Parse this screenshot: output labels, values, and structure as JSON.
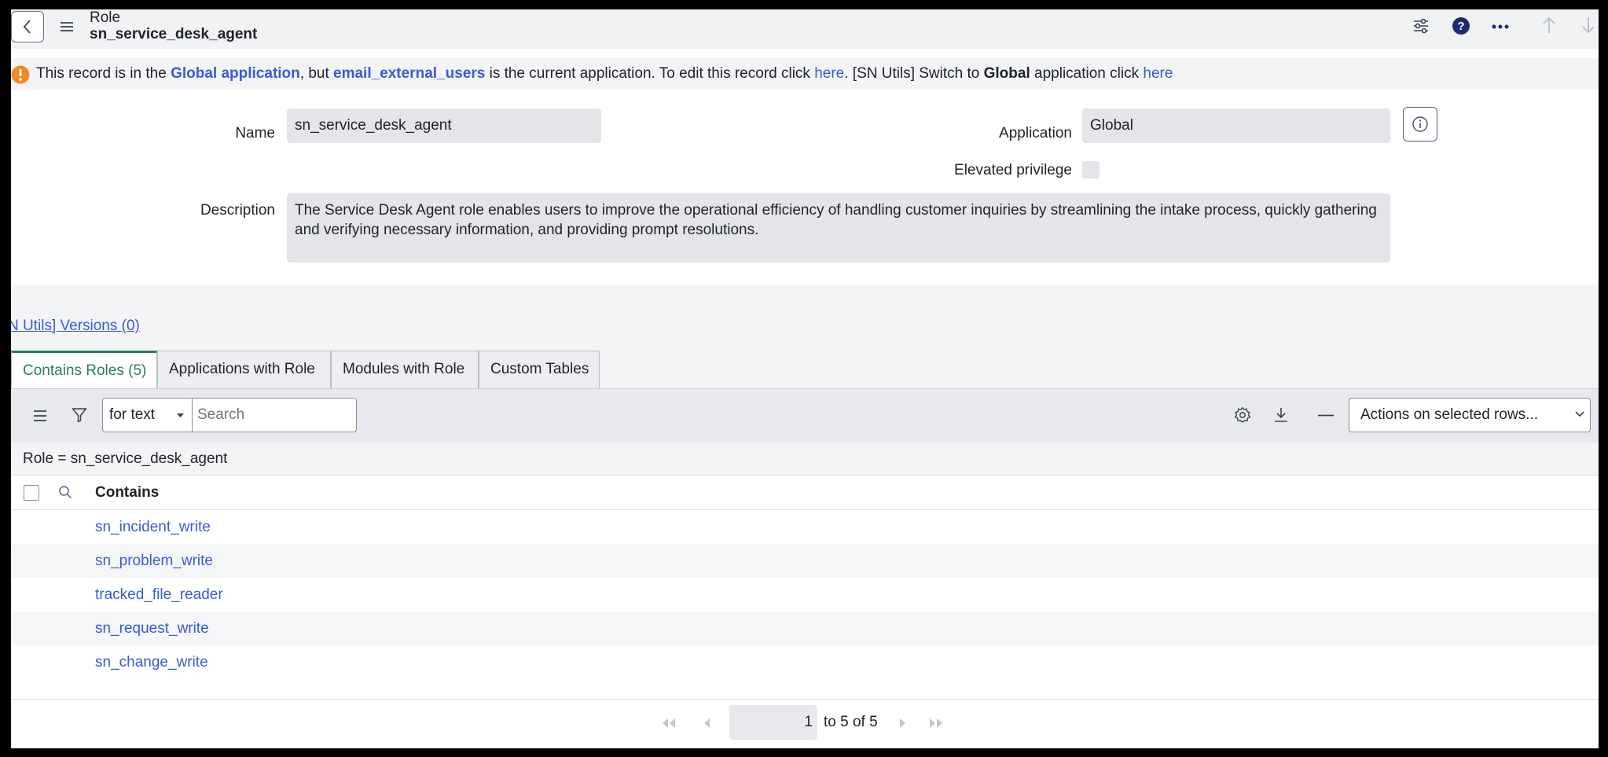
{
  "header": {
    "title": "Role",
    "record_name": "sn_service_desk_agent"
  },
  "banner": {
    "t1": "This record is in the ",
    "global_app": "Global application",
    "t2": ", but ",
    "current_app": "email_external_users",
    "t3": " is the current application. To edit this record click ",
    "here1": "here",
    "t4": ".  [SN Utils] Switch to ",
    "global_bold": "Global",
    "t5": " application click ",
    "here2": "here"
  },
  "form": {
    "name_label": "Name",
    "name_value": "sn_service_desk_agent",
    "application_label": "Application",
    "application_value": "Global",
    "elevated_label": "Elevated privilege",
    "description_label": "Description",
    "description_value": "The Service Desk Agent role enables users to improve the operational efficiency of handling customer inquiries by streamlining the intake process, quickly gathering and verifying necessary information, and providing prompt resolutions."
  },
  "versions_link": "N Utils] Versions (0)",
  "tabs": [
    {
      "label": "Contains Roles (5)",
      "active": true
    },
    {
      "label": "Applications with Role",
      "active": false
    },
    {
      "label": "Modules with Role",
      "active": false
    },
    {
      "label": "Custom Tables",
      "active": false
    }
  ],
  "list": {
    "search_scope": "for text",
    "search_placeholder": "Search",
    "actions_label": "Actions on selected rows...",
    "breadcrumb": "Role = sn_service_desk_agent",
    "column_header": "Contains",
    "rows": [
      "sn_incident_write",
      "sn_problem_write",
      "tracked_file_reader",
      "sn_request_write",
      "sn_change_write"
    ]
  },
  "pagination": {
    "current_page": "1",
    "range_text": "to 5 of 5"
  },
  "colors": {
    "link": "#3b5ad8",
    "active_tab_accent": "#2e7d5b",
    "warning": "#f08a24"
  }
}
